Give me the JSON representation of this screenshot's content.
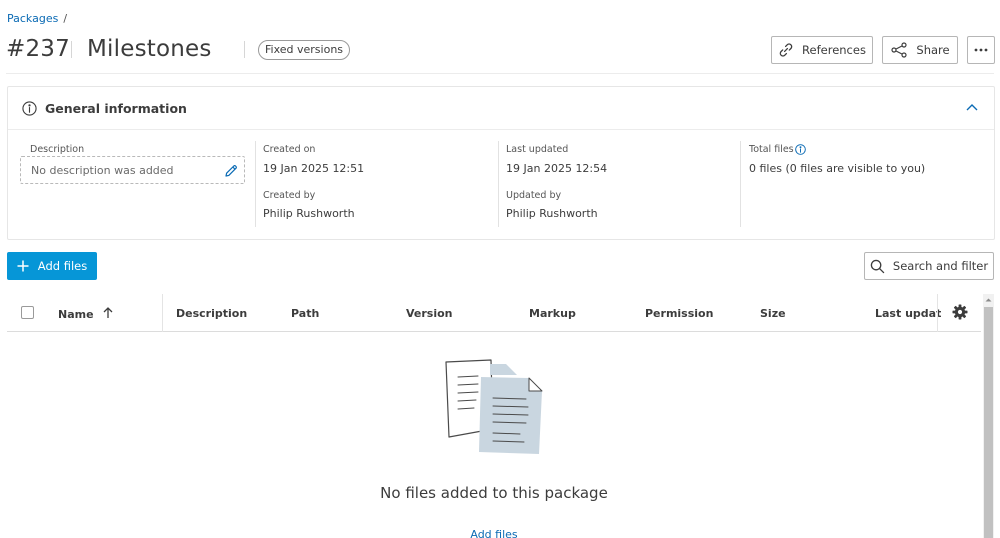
{
  "breadcrumb": {
    "parent": "Packages",
    "separator": "/"
  },
  "package": {
    "number": "#237",
    "name": "Milestones",
    "badge": "Fixed versions"
  },
  "header_actions": {
    "references_label": "References",
    "share_label": "Share",
    "more_icon": "ellipsis-icon"
  },
  "general_info": {
    "title": "General information",
    "description": {
      "label": "Description",
      "placeholder": "No description was added"
    },
    "created_on": {
      "label": "Created on",
      "value": "19 Jan 2025 12:51"
    },
    "created_by": {
      "label": "Created by",
      "value": "Philip Rushworth"
    },
    "last_updated": {
      "label": "Last updated",
      "value": "19 Jan 2025 12:54"
    },
    "updated_by": {
      "label": "Updated by",
      "value": "Philip Rushworth"
    },
    "total_files": {
      "label": "Total files",
      "value": "0 files (0 files are visible to you)"
    }
  },
  "toolbar": {
    "add_files_label": "Add files",
    "search_filter_label": "Search and filter"
  },
  "table": {
    "columns": [
      "Name",
      "Description",
      "Path",
      "Version",
      "Markup",
      "Permission",
      "Size",
      "Last updated"
    ],
    "sort_column": "Name",
    "sort_direction": "ascending"
  },
  "empty_state": {
    "message": "No files added to this package",
    "action_label": "Add files"
  },
  "colors": {
    "accent": "#0696d7",
    "link": "#0a6ab4",
    "text": "#3c3c3c"
  }
}
